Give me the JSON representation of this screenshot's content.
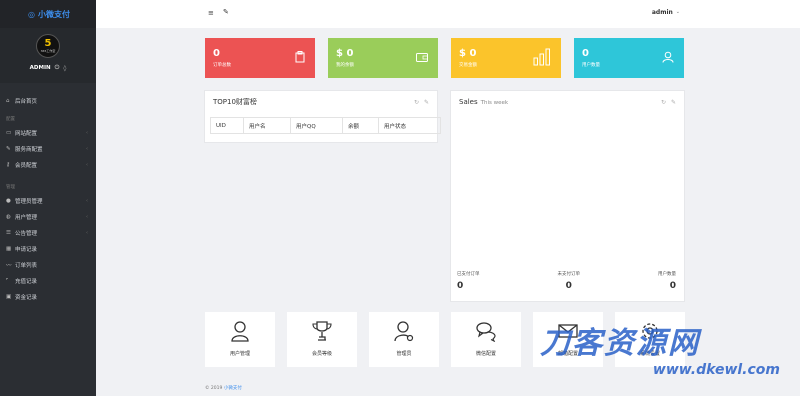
{
  "brand": {
    "name": "小微支付"
  },
  "profile": {
    "avatar_number": "5",
    "avatar_sub": "365工作室",
    "username": "ADMIN"
  },
  "sidebar": {
    "home": {
      "label": "后台首页"
    },
    "section_config": "配置",
    "config_items": [
      {
        "label": "网站配置",
        "icon": "monitor-icon"
      },
      {
        "label": "服务商配置",
        "icon": "wrench-icon"
      },
      {
        "label": "会员配置",
        "icon": "key-icon"
      }
    ],
    "section_manage": "管理",
    "manage_items": [
      {
        "label": "管理员管理",
        "icon": "user-icon"
      },
      {
        "label": "用户管理",
        "icon": "users-icon"
      },
      {
        "label": "公告管理",
        "icon": "list-icon"
      },
      {
        "label": "申请记录",
        "icon": "grid-icon"
      },
      {
        "label": "订单列表",
        "icon": "chart-icon"
      },
      {
        "label": "充值记录",
        "icon": "paypal-icon"
      },
      {
        "label": "资金记录",
        "icon": "cash-icon"
      }
    ]
  },
  "topbar": {
    "user": "admin"
  },
  "stats": [
    {
      "value": "0",
      "label": "订单总数",
      "color": "#ec5353",
      "icon": "clipboard-icon"
    },
    {
      "value": "$ 0",
      "label": "我的余额",
      "color": "#9acd5a",
      "icon": "wallet-icon"
    },
    {
      "value": "$ 0",
      "label": "交易金额",
      "color": "#fbc42b",
      "icon": "bar-chart-icon"
    },
    {
      "value": "0",
      "label": "用户数量",
      "color": "#2ec6d9",
      "icon": "user-add-icon"
    }
  ],
  "top10": {
    "title": "TOP10财富榜",
    "columns": [
      "UID",
      "用户名",
      "用户QQ",
      "余额",
      "用户状态"
    ]
  },
  "sales": {
    "title": "Sales",
    "subtitle": "This week",
    "items": [
      {
        "label": "已支付订单",
        "value": "0"
      },
      {
        "label": "未支付订单",
        "value": "0"
      },
      {
        "label": "用户数量",
        "value": "0"
      }
    ]
  },
  "shortcuts": [
    {
      "label": "用户管理",
      "icon": "user-icon"
    },
    {
      "label": "会员等级",
      "icon": "trophy-icon"
    },
    {
      "label": "管理员",
      "icon": "user-cog-icon"
    },
    {
      "label": "微信配置",
      "icon": "chat-icon"
    },
    {
      "label": "邮箱配置",
      "icon": "envelope-icon"
    },
    {
      "label": "系统设置",
      "icon": "gear-icon"
    }
  ],
  "footer": {
    "copyright": "© 2019",
    "link": "小微支付"
  },
  "watermark": {
    "main": "刀客资源网",
    "url": "www.dkewl.com"
  }
}
